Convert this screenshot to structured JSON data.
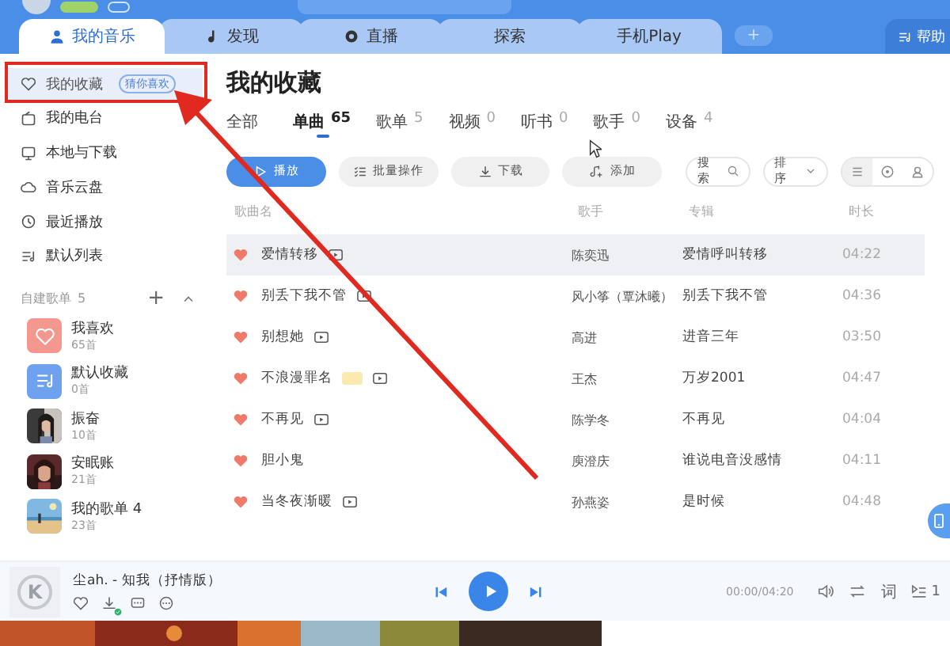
{
  "nav_tabs": [
    {
      "label": "我的音乐",
      "selected": true
    },
    {
      "label": "发现",
      "selected": false
    },
    {
      "label": "直播",
      "selected": false
    },
    {
      "label": "探索",
      "selected": false
    },
    {
      "label": "手机Play",
      "selected": false
    }
  ],
  "new_tab": "+",
  "help_button": "帮助",
  "sidebar": {
    "items": [
      {
        "label": "我的收藏",
        "selected": true,
        "badge": "猜你喜欢"
      },
      {
        "label": "我的电台",
        "selected": false
      },
      {
        "label": "本地与下载",
        "selected": false
      },
      {
        "label": "音乐云盘",
        "selected": false
      },
      {
        "label": "最近播放",
        "selected": false
      },
      {
        "label": "默认列表",
        "selected": false
      }
    ],
    "section": {
      "title": "自建歌单",
      "count": "5",
      "add": "+"
    },
    "playlists": [
      {
        "name": "我喜欢",
        "count": "65首",
        "kind": "favorites"
      },
      {
        "name": "默认收藏",
        "count": "0首",
        "kind": "default"
      },
      {
        "name": "振奋",
        "count": "10首",
        "kind": "picture"
      },
      {
        "name": "安眠账",
        "count": "21首",
        "kind": "picture"
      },
      {
        "name": "我的歌单 4",
        "count": "23首",
        "kind": "picture"
      }
    ]
  },
  "page_title": "我的收藏",
  "filter_tabs": [
    {
      "label": "全部",
      "selected": false
    },
    {
      "label": "单曲",
      "count": "65",
      "selected": true
    },
    {
      "label": "歌单",
      "count": "5",
      "selected": false
    },
    {
      "label": "视频",
      "count": "0",
      "selected": false
    },
    {
      "label": "听书",
      "count": "0",
      "selected": false
    },
    {
      "label": "歌手",
      "count": "0",
      "selected": false
    },
    {
      "label": "设备",
      "count": "4",
      "selected": false
    }
  ],
  "actions": [
    {
      "label": "播放",
      "kind": "primary"
    },
    {
      "label": "批量操作",
      "kind": "plain"
    },
    {
      "label": "下载",
      "kind": "plain"
    },
    {
      "label": "添加",
      "kind": "plain"
    }
  ],
  "search_label": "搜索",
  "sort_label": "排序",
  "views": [
    {
      "selected": true
    },
    {
      "selected": false
    },
    {
      "selected": false
    }
  ],
  "table": {
    "columns": [
      "歌曲名",
      "歌手",
      "专辑",
      "时长"
    ],
    "rows": [
      {
        "title": "爱情转移",
        "has_mv": true,
        "vip": false,
        "artist": "陈奕迅",
        "album": "爱情呼叫转移",
        "duration": "04:22",
        "liked": true,
        "selected": true
      },
      {
        "title": "别丢下我不管",
        "has_mv": true,
        "vip": false,
        "artist": "风小筝（覃沐曦）",
        "album": "别丢下我不管",
        "duration": "04:36",
        "liked": true,
        "selected": false
      },
      {
        "title": "别想她",
        "has_mv": true,
        "vip": false,
        "artist": "高进",
        "album": "进音三年",
        "duration": "03:50",
        "liked": true,
        "selected": false
      },
      {
        "title": "不浪漫罪名",
        "has_mv": true,
        "vip": true,
        "artist": "王杰",
        "album": "万岁2001",
        "duration": "04:47",
        "liked": true,
        "selected": false
      },
      {
        "title": "不再见",
        "has_mv": true,
        "vip": false,
        "artist": "陈学冬",
        "album": "不再见",
        "duration": "04:04",
        "liked": true,
        "selected": false
      },
      {
        "title": "胆小鬼",
        "has_mv": false,
        "vip": false,
        "artist": "庾澄庆",
        "album": "谁说电音没感情",
        "duration": "04:11",
        "liked": true,
        "selected": false
      },
      {
        "title": "当冬夜渐暖",
        "has_mv": true,
        "vip": false,
        "artist": "孙燕姿",
        "album": "是时候",
        "duration": "04:48",
        "liked": true,
        "selected": false
      }
    ]
  },
  "player": {
    "track": "尘ah. - 知我（抒情版）",
    "cover_letter": "K",
    "time": "00:00/04:20",
    "lyrics": "词",
    "queue_count": "1",
    "downloaded": true
  }
}
